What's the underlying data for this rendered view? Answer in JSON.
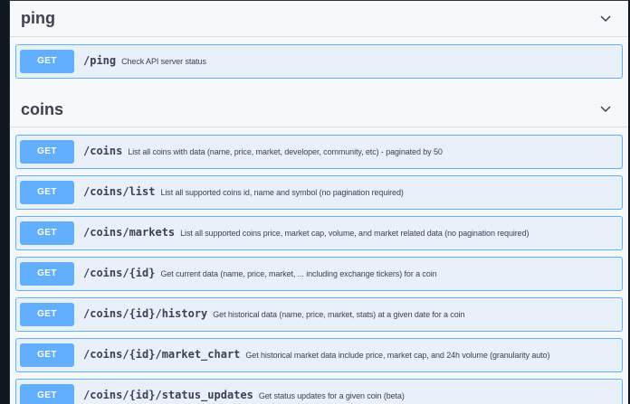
{
  "sections": [
    {
      "title": "ping",
      "operations": [
        {
          "method": "GET",
          "path": "/ping",
          "summary": "Check API server status"
        }
      ]
    },
    {
      "title": "coins",
      "operations": [
        {
          "method": "GET",
          "path": "/coins",
          "summary": "List all coins with data (name, price, market, developer, community, etc) - paginated by 50"
        },
        {
          "method": "GET",
          "path": "/coins/list",
          "summary": "List all supported coins id, name and symbol (no pagination required)"
        },
        {
          "method": "GET",
          "path": "/coins/markets",
          "summary": "List all supported coins price, market cap, volume, and market related data (no pagination required)"
        },
        {
          "method": "GET",
          "path": "/coins/{id}",
          "summary": "Get current data (name, price, market, ... including exchange tickers) for a coin"
        },
        {
          "method": "GET",
          "path": "/coins/{id}/history",
          "summary": "Get historical data (name, price, market, stats) at a given date for a coin"
        },
        {
          "method": "GET",
          "path": "/coins/{id}/market_chart",
          "summary": "Get historical market data include price, market cap, and 24h volume (granularity auto)"
        },
        {
          "method": "GET",
          "path": "/coins/{id}/status_updates",
          "summary": "Get status updates for a given coin (beta)"
        }
      ]
    }
  ],
  "colors": {
    "get_accent": "#61affe",
    "get_background": "#e8f1fa"
  },
  "icons": {
    "collapse": "chevron-down-icon"
  }
}
